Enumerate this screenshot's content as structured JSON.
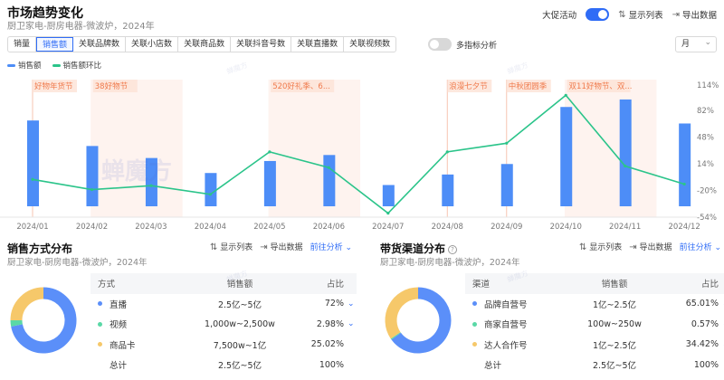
{
  "header": {
    "title": "市场趋势变化",
    "subtitle": "厨卫家电-厨房电器-微波炉，2024年",
    "promo_label": "大促活动",
    "show_list": "显示列表",
    "export": "导出数据"
  },
  "tabs": [
    "销量",
    "销售额",
    "关联品牌数",
    "关联小店数",
    "关联商品数",
    "关联抖音号数",
    "关联直播数",
    "关联视频数"
  ],
  "multi_label": "多指标分析",
  "period": "月",
  "legend": {
    "bar": "销售额",
    "line": "销售额环比"
  },
  "colors": {
    "bar": "#4d8df7",
    "line": "#2bc48a",
    "promo": "#f7b49a",
    "accent": "#2f6cf6"
  },
  "watermark": "蝉魔方",
  "chart_data": {
    "type": "bar",
    "categories": [
      "2024/01",
      "2024/02",
      "2024/03",
      "2024/04",
      "2024/05",
      "2024/06",
      "2024/07",
      "2024/08",
      "2024/09",
      "2024/10",
      "2024/11",
      "2024/12"
    ],
    "series": [
      {
        "name": "销售额",
        "type": "bar",
        "values": [
          62,
          45,
          37,
          27,
          35,
          39,
          19,
          26,
          33,
          71,
          76,
          60
        ]
      },
      {
        "name": "销售额环比",
        "type": "line",
        "values": [
          -6,
          -19,
          -14,
          -25,
          29,
          9,
          -49,
          29,
          40,
          101,
          11,
          -12
        ]
      }
    ],
    "right_axis": {
      "ticks": [
        "114%",
        "82%",
        "48%",
        "14%",
        "-20%",
        "-54%"
      ],
      "ylim": [
        -54,
        114
      ]
    },
    "promos": [
      {
        "label": "好物年货节",
        "start": 0,
        "end": 0
      },
      {
        "label": "38好物节",
        "start": 1,
        "end": 2
      },
      {
        "label": "520好礼季、6...",
        "start": 4,
        "end": 5
      },
      {
        "label": "浪漫七夕节",
        "start": 7,
        "end": 7
      },
      {
        "label": "中秋团圆季",
        "start": 8,
        "end": 8
      },
      {
        "label": "双11好物节、双...",
        "start": 9,
        "end": 10
      }
    ]
  },
  "left_panel": {
    "title": "销售方式分布",
    "subtitle": "厨卫家电-厨房电器-微波炉，2024年",
    "actions": {
      "show_list": "显示列表",
      "export": "导出数据",
      "analysis": "前往分析"
    },
    "headers": {
      "c1": "方式",
      "c2": "销售额",
      "c3": "占比"
    },
    "rows": [
      {
        "name": "直播",
        "value": "2.5亿~5亿",
        "share": "72%",
        "color": "#5b8ff9",
        "expand": true
      },
      {
        "name": "视频",
        "value": "1,000w~2,500w",
        "share": "2.98%",
        "color": "#5ad8a6",
        "expand": true
      },
      {
        "name": "商品卡",
        "value": "7,500w~1亿",
        "share": "25.02%",
        "color": "#f6c86a",
        "expand": false
      }
    ],
    "total": {
      "name": "总计",
      "value": "2.5亿~5亿",
      "share": "100%"
    },
    "donut": [
      72,
      2.98,
      25.02
    ]
  },
  "right_panel": {
    "title": "带货渠道分布",
    "subtitle": "厨卫家电-厨房电器-微波炉，2024年",
    "actions": {
      "show_list": "显示列表",
      "export": "导出数据",
      "analysis": "前往分析"
    },
    "headers": {
      "c1": "渠道",
      "c2": "销售额",
      "c3": "占比"
    },
    "rows": [
      {
        "name": "品牌自营号",
        "value": "1亿~2.5亿",
        "share": "65.01%",
        "color": "#5b8ff9",
        "expand": true
      },
      {
        "name": "商家自营号",
        "value": "100w~250w",
        "share": "0.57%",
        "color": "#5ad8a6",
        "expand": true
      },
      {
        "name": "达人合作号",
        "value": "1亿~2.5亿",
        "share": "34.42%",
        "color": "#f6c86a",
        "expand": true
      }
    ],
    "total": {
      "name": "总计",
      "value": "2.5亿~5亿",
      "share": "100%"
    },
    "donut": [
      65.01,
      0.57,
      34.42
    ]
  }
}
